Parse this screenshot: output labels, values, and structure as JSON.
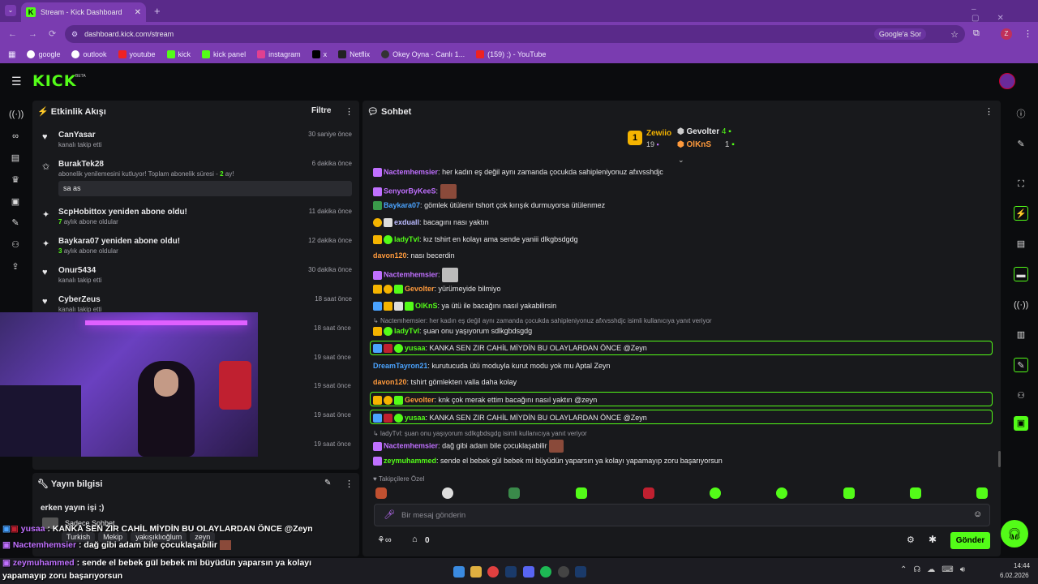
{
  "browser": {
    "tab_title": "Stream - Kick Dashboard",
    "url": "dashboard.kick.com/stream",
    "google_btn": "Google'a Sor",
    "profile_letter": "Z"
  },
  "bookmarks": [
    "google",
    "outlook",
    "youtube",
    "kick",
    "kick panel",
    "instagram",
    "x",
    "Netflix",
    "Okey Oyna - Canlı 1...",
    "(159) ;) - YouTube"
  ],
  "activity": {
    "title": "Etkinlik Akışı",
    "filter": "Filtre",
    "items": [
      {
        "name": "CanYasar",
        "sub": "kanalı takip etti",
        "time": "30 saniye önce"
      },
      {
        "name": "BurakTek28",
        "sub": "abonelik yenilemesini kutluyor! Toplam abonelik süresi -",
        "sub_count": "2",
        "sub_suffix": "ay!",
        "note": "sa as",
        "time": "6 dakika önce"
      },
      {
        "name": "ScpHobittox yeniden abone oldu!",
        "count": "7",
        "sub": "aylık abone oldular",
        "time": "11 dakika önce"
      },
      {
        "name": "Baykara07 yeniden abone oldu!",
        "count": "3",
        "sub": "aylık abone oldular",
        "time": "12 dakika önce"
      },
      {
        "name": "Onur5434",
        "sub": "kanalı takip etti",
        "time": "30 dakika önce"
      },
      {
        "name": "CyberZeus",
        "sub": "kanalı takip etti",
        "time": "18 saat önce"
      }
    ],
    "extra_times": [
      "18 saat önce",
      "19 saat önce",
      "19 saat önce",
      "19 saat önce",
      "19 saat önce"
    ]
  },
  "stream_info": {
    "title": "Yayın bilgisi",
    "stream_title": "erken yayın işi ;)",
    "mode": "Sadece Sohbet",
    "tags": [
      "Turkish",
      "Mekip",
      "yakışıklıoğlum",
      "zeyn"
    ]
  },
  "chat": {
    "title": "Sohbet",
    "top": {
      "first_name": "Zewiio",
      "first_count": "19",
      "rank": "1",
      "second_name": "Gevolter",
      "second_count": "4",
      "third_name": "OlKnS",
      "third_count": "1"
    },
    "messages": [
      {
        "user": "Nactemhemsier",
        "color": "#c070ff",
        "text": "her kadın eş değil aynı zamanda çocukda sahipleniyonuz afxvsshdjc"
      },
      {
        "user": "SenyorByKeeS",
        "color": "#c070ff",
        "text": ""
      },
      {
        "user": "Baykara07",
        "color": "#4aa3ff",
        "text": "gömlek ütülenir tshort çok kırışık durmuyorsa ütülenmez"
      },
      {
        "user": "exduall",
        "color": "#bbbbff",
        "text": "bacagını nası yaktın"
      },
      {
        "user": "ladyTvl",
        "color": "#53fc18",
        "text": "kız tshirt en kolayı ama sende yaniii dlkgbsdgdg"
      },
      {
        "user": "davon120",
        "color": "#ff9a3c",
        "text": "nası becerdin"
      },
      {
        "user": "Nactemhemsier",
        "color": "#c070ff",
        "text": ""
      },
      {
        "user": "Gevolter",
        "color": "#ff9a3c",
        "text": "yürümeyide bilmiyo"
      },
      {
        "user": "OlKnS",
        "color": "#53fc18",
        "text": "ya ütü ile bacağını nasıl yakabilirsin"
      }
    ],
    "reply1": "Nactemhemsier: her kadın eş değil aynı zamanda çocukda sahipleniyonuz afxvsshdjc  isimli kullanıcıya yanıt veriyor",
    "messages2": [
      {
        "user": "ladyTvl",
        "color": "#53fc18",
        "text": "şuan onu yaşıyorum sdlkgbdsgdg"
      },
      {
        "user": "yusaa",
        "color": "#53fc18",
        "text": "KANKA SEN ZIR CAHİL MİYDİN BU OLAYLARDAN ÖNCE @Zeyn"
      },
      {
        "user": "DreamTayron21",
        "color": "#4aa3ff",
        "text": "kurutucuda ütü moduyla kurut modu yok mu Aptal Zeyn"
      },
      {
        "user": "davon120",
        "color": "#ff9a3c",
        "text": "tshirt gömlekten valla daha kolay"
      },
      {
        "user": "Gevolter",
        "color": "#ff9a3c",
        "text": "knk çok merak ettim bacağını nasıl yaktın @zeyn"
      },
      {
        "user": "yusaa",
        "color": "#53fc18",
        "text": "KANKA SEN ZIR CAHİL MİYDİN BU OLAYLARDAN ÖNCE @Zeyn"
      }
    ],
    "reply2": "ladyTvl: şuan onu yaşıyorum sdlkgbdsgdg isimli kullanıcıya yanıt veriyor",
    "messages3": [
      {
        "user": "Nactemhemsier",
        "color": "#c070ff",
        "text": "dağ gibi adam bile çocuklaşabilir"
      },
      {
        "user": "zeymuhammed",
        "color": "#53fc18",
        "text": "sende el bebek gül bebek mi büyüdün yaparsın ya kolayı yapamayıp zoru başarıyorsun"
      }
    ],
    "followers_only": "Takipçilere Özel",
    "input_placeholder": "Bir mesaj gönderin",
    "points": "0",
    "send": "Gönder"
  },
  "overlay": {
    "l1_user": "yusaa",
    "l1_text": "KANKA SEN ZIR CAHİL MİYDİN BU OLAYLARDAN ÖNCE @Zeyn",
    "l2_user": "Nactemhemsier",
    "l2_text": "dağ gibi adam bile çocuklaşabilir",
    "l3_user": "zeymuhammed",
    "l3_text": "sende el bebek gül bebek mi büyüdün yaparsın ya kolayı",
    "l4_text": "yapamayıp zoru başarıyorsun"
  },
  "taskbar": {
    "time": "14:44",
    "date": "6.02.2026"
  },
  "colors": {
    "kick_green": "#53fc18",
    "browser_purple": "#7a3cb0",
    "panel": "#18191c"
  }
}
